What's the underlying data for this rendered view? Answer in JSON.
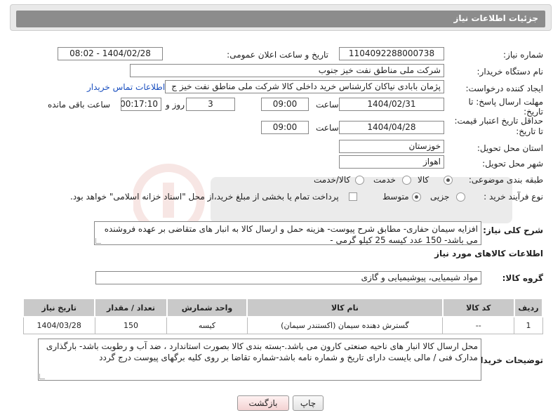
{
  "header": {
    "title": "جزئیات اطلاعات نیاز"
  },
  "fields": {
    "need_number": {
      "label": "شماره نیاز:",
      "value": "1104092288000738"
    },
    "announce_datetime": {
      "label": "تاریخ و ساعت اعلان عمومی:",
      "value": "1404/02/28 - 08:02"
    },
    "buyer_org": {
      "label": "نام دستگاه خریدار:",
      "value": "شرکت ملی مناطق نفت خیز جنوب"
    },
    "requester": {
      "label": "ایجاد کننده درخواست:",
      "value": "پژمان  بابادی نیاکان  کارشناس خرید داخلی کالا  شرکت ملی مناطق نفت خیز ج",
      "contact_link": "اطلاعات تماس خریدار"
    },
    "reply_deadline": {
      "label_line1": "مهلت ارسال پاسخ: تا",
      "label_line2": "تاریخ:",
      "date": "1404/02/31",
      "time_label": "ساعت",
      "time": "09:00",
      "days": "3",
      "days_label": "روز و",
      "remaining": "00:17:10",
      "remaining_label": "ساعت باقی مانده"
    },
    "price_validity": {
      "label_line1": "حداقل تاریخ اعتبار قیمت:",
      "label_line2": "تا تاریخ:",
      "date": "1404/04/28",
      "time_label": "ساعت",
      "time": "09:00"
    },
    "province": {
      "label": "استان محل تحویل:",
      "value": "خوزستان"
    },
    "city": {
      "label": "شهر محل تحویل:",
      "value": "اهواز"
    },
    "category": {
      "label": "طبقه بندی موضوعی:",
      "options": [
        "کالا",
        "خدمت",
        "کالا/خدمت"
      ],
      "selected": "کالا"
    },
    "process_type": {
      "label": "نوع فرآیند خرید :",
      "options": [
        "جزیی",
        "متوسط"
      ],
      "selected": "متوسط",
      "payment_note": "پرداخت تمام یا بخشی از مبلغ خرید،از محل \"اسناد خزانه اسلامی\" خواهد بود."
    }
  },
  "description": {
    "label": "شرح کلی نیاز:",
    "text": "افزایه سیمان حفاری- مطابق شرح پیوست- هزینه حمل و ارسال کالا به انبار های  متقاضی بر عهده فروشنده می باشد- 150 عدد کیسه 25 کیلو گرمی -"
  },
  "goods_section": {
    "title": "اطلاعات کالاهای مورد نیاز",
    "group_label": "گروه کالا:",
    "group_value": "مواد شیمیایی، پیوشیمیایی و  گازی"
  },
  "table": {
    "headers": [
      "ردیف",
      "کد کالا",
      "نام کالا",
      "واحد شمارش",
      "تعداد / مقدار",
      "تاریخ نیاز"
    ],
    "rows": [
      [
        "1",
        "--",
        "گسترش دهنده سیمان (اکستندر سیمان)",
        "کیسه",
        "150",
        "1404/03/28"
      ]
    ]
  },
  "buyer_notes": {
    "label": "توضیحات خریدار:",
    "text": "محل ارسال کالا انبار های ناحیه صنعتی کارون می باشد.-بسته بندی کالا بصورت استاندارد ، ضد آب و رطوبت باشد- بارگذاری مدارک  فنی / مالی بایست دارای تاریخ و شماره نامه باشد-شماره تقاضا بر روی کلیه برگهای پیوست درج گردد"
  },
  "buttons": {
    "print": "چاپ",
    "back": "بازگشت"
  },
  "colors": {
    "header": "#8c8c8c",
    "link": "#1a4fbf",
    "table_header": "#c9c9c9",
    "watermark": "#c0392b"
  }
}
